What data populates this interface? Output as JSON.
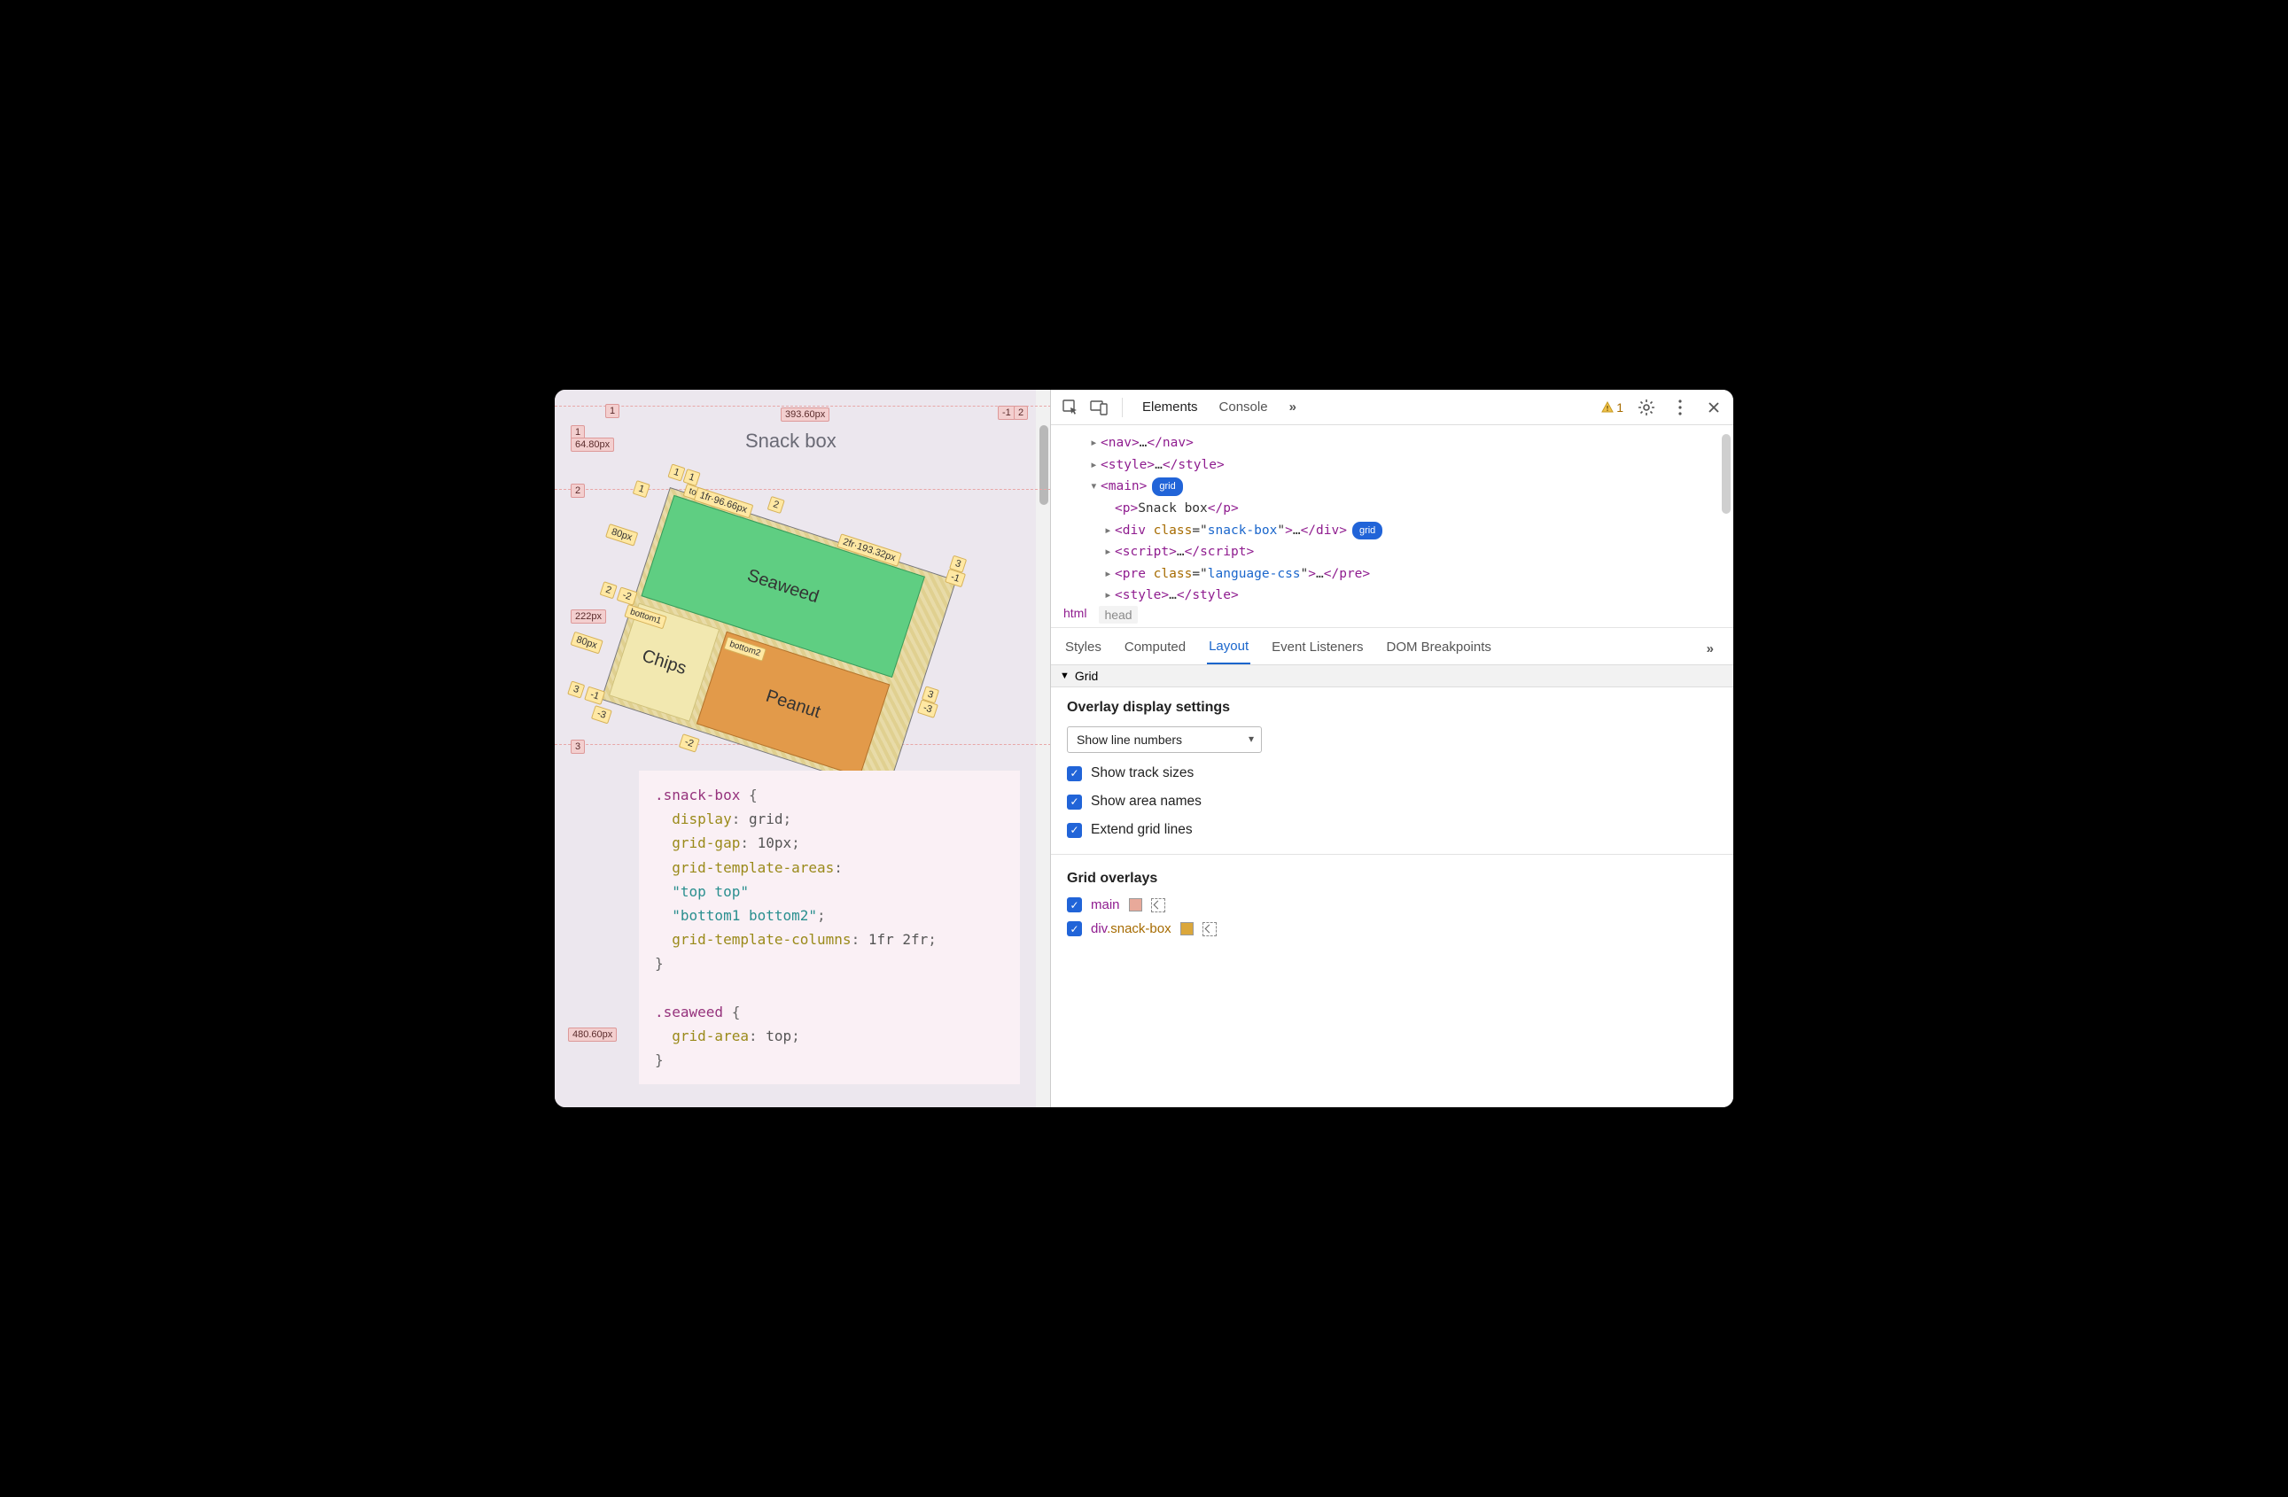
{
  "viewport": {
    "title": "Snack box",
    "cells": {
      "seaweed": "Seaweed",
      "chips": "Chips",
      "peanut": "Peanut"
    },
    "labels": {
      "row1": "1",
      "row2": "2",
      "row3": "3",
      "neg1": "-1",
      "neg2": "-2",
      "neg3": "-3",
      "size_64_80": "64.80px",
      "size_393_60": "393.60px",
      "size_222": "222px",
      "size_480_60": "480.60px",
      "size_80a": "80px",
      "size_80b": "80px",
      "track_1fr": "1fr·96.66px",
      "track_2fr": "2fr·193.32px",
      "top": "top",
      "bottom1": "bottom1",
      "bottom2": "bottom2"
    },
    "code": {
      "l1_sel": ".snack-box",
      "l1_brace": " {",
      "l2_p": "display",
      "l2_v": "grid",
      "l3_p": "grid-gap",
      "l3_v": "10px",
      "l4_p": "grid-template-areas",
      "l5_s": "\"top top\"",
      "l6_s": "\"bottom1 bottom2\"",
      "l7_p": "grid-template-columns",
      "l7_v": "1fr 2fr",
      "l8": "}",
      "l10_sel": ".seaweed",
      "l10_brace": " {",
      "l11_p": "grid-area",
      "l11_v": "top",
      "l12": "}"
    }
  },
  "devtools": {
    "tabs": {
      "elements": "Elements",
      "console": "Console"
    },
    "issue_count": "1",
    "dom": {
      "nav": "nav",
      "style": "style",
      "main": "main",
      "main_badge": "grid",
      "p_text": "Snack box",
      "div_class": "snack-box",
      "div_badge": "grid",
      "script": "script",
      "pre_class": "language-css",
      "style2": "style"
    },
    "crumbs": {
      "html": "html",
      "head": "head"
    },
    "subtabs": {
      "styles": "Styles",
      "computed": "Computed",
      "layout": "Layout",
      "event": "Event Listeners",
      "dom": "DOM Breakpoints"
    },
    "section": "Grid",
    "overlay": {
      "heading": "Overlay display settings",
      "select": "Show line numbers",
      "track_sizes": "Show track sizes",
      "area_names": "Show area names",
      "extend": "Extend grid lines"
    },
    "overlays": {
      "heading": "Grid overlays",
      "main": "main",
      "snack_prefix": "div",
      "snack_class": ".snack-box"
    },
    "colors": {
      "main": "#e8a99a",
      "snack": "#dba73b"
    }
  }
}
